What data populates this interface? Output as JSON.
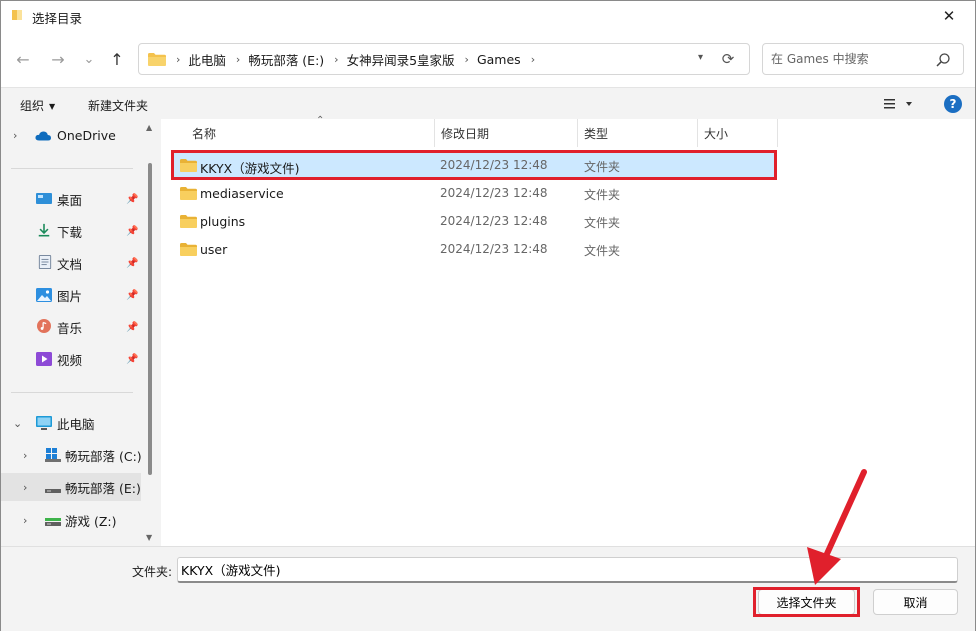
{
  "window": {
    "title": "选择目录",
    "close_glyph": "✕"
  },
  "nav": {
    "back_glyph": "←",
    "forward_glyph": "→",
    "recent_glyph": "⌄",
    "up_glyph": "↑",
    "breadcrumbs": [
      "此电脑",
      "畅玩部落 (E:)",
      "女神异闻录5皇家版",
      "Games"
    ],
    "refresh_glyph": "⟳",
    "search_placeholder": "在 Games 中搜索"
  },
  "toolbar": {
    "organize_label": "组织",
    "new_folder_label": "新建文件夹",
    "help_glyph": "?"
  },
  "sidebar": {
    "onedrive": "OneDrive",
    "quick_access": [
      {
        "label": "桌面",
        "icon": "desktop-icon"
      },
      {
        "label": "下载",
        "icon": "download-icon"
      },
      {
        "label": "文档",
        "icon": "document-icon"
      },
      {
        "label": "图片",
        "icon": "pictures-icon"
      },
      {
        "label": "音乐",
        "icon": "music-icon"
      },
      {
        "label": "视频",
        "icon": "video-icon"
      }
    ],
    "this_pc": "此电脑",
    "drives": [
      {
        "label": "畅玩部落 (C:)",
        "icon": "windows-drive-icon"
      },
      {
        "label": "畅玩部落 (E:)",
        "icon": "drive-icon",
        "selected": true
      },
      {
        "label": "游戏 (Z:)",
        "icon": "drive-icon"
      }
    ]
  },
  "columns": [
    "名称",
    "修改日期",
    "类型",
    "大小"
  ],
  "files": [
    {
      "name": "KKYX（游戏文件)",
      "date": "2024/12/23 12:48",
      "type": "文件夹",
      "selected": true
    },
    {
      "name": "mediaservice",
      "date": "2024/12/23 12:48",
      "type": "文件夹"
    },
    {
      "name": "plugins",
      "date": "2024/12/23 12:48",
      "type": "文件夹"
    },
    {
      "name": "user",
      "date": "2024/12/23 12:48",
      "type": "文件夹"
    }
  ],
  "bottom": {
    "folder_label": "文件夹:",
    "folder_value": "KKYX（游戏文件)",
    "select_button": "选择文件夹",
    "cancel_button": "取消"
  },
  "colors": {
    "selection": "#cce8ff",
    "highlight_box": "#e0202c",
    "folder": "#f4c24d",
    "help": "#1b6ec2"
  }
}
